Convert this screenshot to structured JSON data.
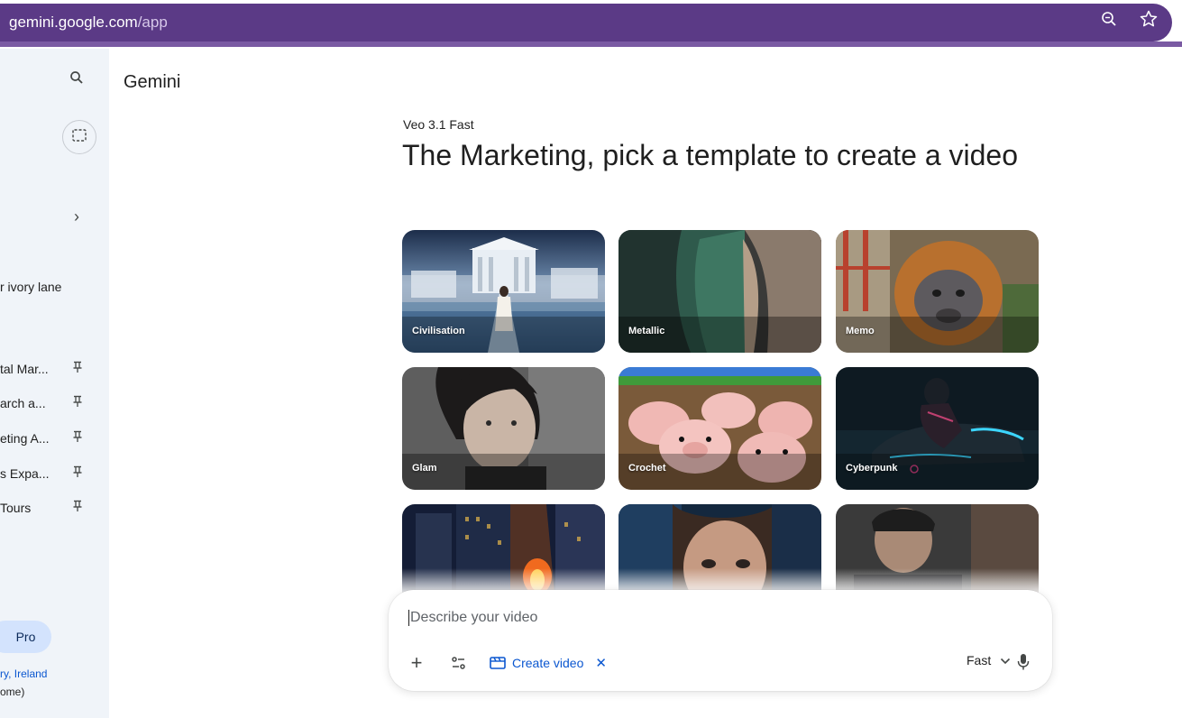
{
  "browser": {
    "url_host": "gemini.google.com",
    "url_path": "/app",
    "icons": [
      "zoom-icon",
      "bookmark-star-icon"
    ]
  },
  "sidebar": {
    "icons": [
      "search-icon",
      "new-chat-icon",
      "expand-chevron-icon"
    ],
    "gem_label": "r ivory lane",
    "chats": [
      {
        "label": "tal Mar..."
      },
      {
        "label": "arch a..."
      },
      {
        "label": "eting A..."
      },
      {
        "label": "s Expa..."
      },
      {
        "label": "Tours"
      }
    ],
    "upgrade_label": "Pro",
    "location": "ry, Ireland",
    "location_source": "ome)"
  },
  "main": {
    "brand": "Gemini",
    "model": "Veo 3.1 Fast",
    "headline": "The Marketing, pick a template to create a video",
    "templates": [
      {
        "label": "Civilisation"
      },
      {
        "label": "Metallic"
      },
      {
        "label": "Memo"
      },
      {
        "label": "Glam"
      },
      {
        "label": "Crochet"
      },
      {
        "label": "Cyberpunk"
      },
      {
        "label": ""
      },
      {
        "label": ""
      },
      {
        "label": ""
      }
    ]
  },
  "composer": {
    "placeholder": "Describe your video",
    "create_label": "Create video",
    "mode": "Fast",
    "icons": [
      "plus-icon",
      "tools-icon",
      "video-icon",
      "close-icon",
      "chevron-down-icon",
      "mic-icon"
    ]
  },
  "colors": {
    "browser_bar": "#5b3a86",
    "sidebar_bg": "#f0f4f9",
    "accent": "#0b57d0",
    "pro_pill": "#d3e3fd"
  }
}
